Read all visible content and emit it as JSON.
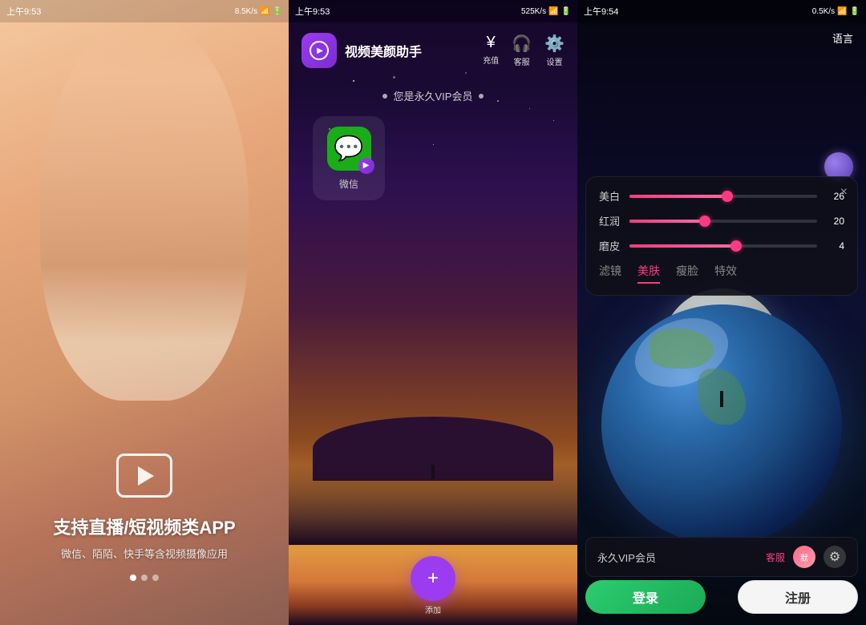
{
  "panel1": {
    "statusbar": {
      "time": "上午9:53",
      "network": "8.5K/s",
      "icons": "🔋📶"
    },
    "title": "支持直播/短视频类APP",
    "subtitle": "微信、陌陌、快手等含视频摄像应用",
    "dots": [
      true,
      false,
      false
    ]
  },
  "panel2": {
    "statusbar": {
      "time": "上午9:53",
      "network": "525K/s"
    },
    "header": {
      "appname": "视频美颜助手",
      "charge_label": "充值",
      "service_label": "客服",
      "settings_label": "设置"
    },
    "vip_text": "您是永久VIP会员",
    "wechat_label": "微信",
    "add_label": "添加"
  },
  "panel3": {
    "statusbar": {
      "time": "上午9:54",
      "network": "0.5K/s"
    },
    "lang_label": "语言",
    "beauty_panel": {
      "close": "×",
      "sliders": [
        {
          "label": "美白",
          "value": 26,
          "pct": 52
        },
        {
          "label": "红润",
          "value": 20,
          "pct": 40
        },
        {
          "label": "磨皮",
          "value": 4,
          "pct": 57
        }
      ],
      "tabs": [
        {
          "label": "滤镜",
          "active": false
        },
        {
          "label": "美肤",
          "active": true
        },
        {
          "label": "瘦脸",
          "active": false
        },
        {
          "label": "特效",
          "active": false
        }
      ]
    },
    "bottom_bar": {
      "vip_label": "永久VIP会员",
      "cs_label": "客服",
      "beauty_icon": "默"
    },
    "login_label": "登录",
    "register_label": "注册"
  }
}
